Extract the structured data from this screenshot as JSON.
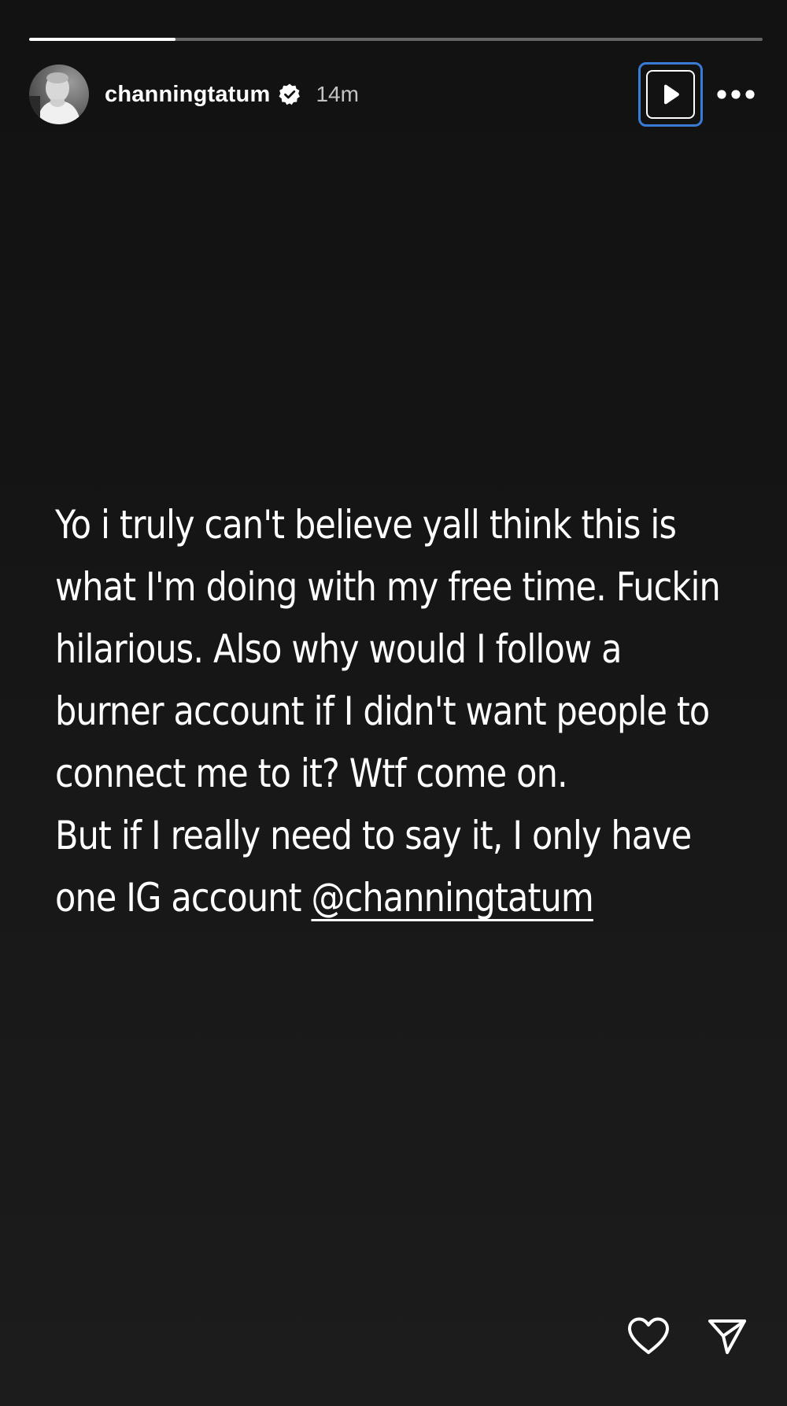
{
  "progress": {
    "fraction": 0.2
  },
  "header": {
    "username": "channingtatum",
    "verified": true,
    "time": "14m",
    "play_icon": "play-icon",
    "more_icon": "more-horizontal-icon"
  },
  "story": {
    "lines": [
      "Yo i truly can't believe yall think this is",
      "what I'm doing with my free time. Fuckin",
      "hilarious. Also why would I follow a",
      "burner account if I didn't want people to",
      "connect me to it? Wtf come on.",
      "But if I really need to say it, I only have"
    ],
    "last_line_prefix": "one IG account ",
    "mention": "@channingtatum"
  },
  "footer": {
    "like_icon": "heart-icon",
    "share_icon": "send-icon"
  },
  "colors": {
    "accent_focus": "#3a7bd5",
    "text": "#ffffff"
  }
}
